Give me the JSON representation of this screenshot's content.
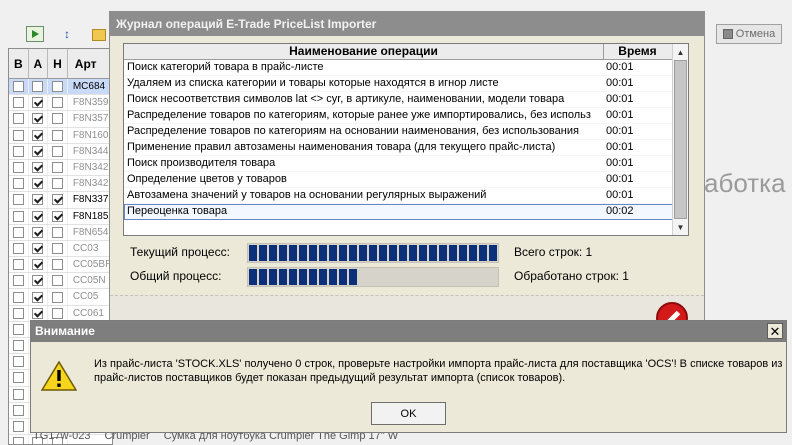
{
  "app": {
    "cancel_label": "Отмена",
    "grid_headers": [
      "В",
      "А",
      "Н",
      "Арт"
    ],
    "grid_rows": [
      {
        "a": false,
        "n": false,
        "art": "MC684",
        "dark": true,
        "sel": true
      },
      {
        "a": true,
        "n": false,
        "art": "F8N359",
        "dark": false
      },
      {
        "a": true,
        "n": false,
        "art": "F8N357",
        "dark": false
      },
      {
        "a": true,
        "n": false,
        "art": "F8N160",
        "dark": false
      },
      {
        "a": true,
        "n": false,
        "art": "F8N344",
        "dark": false
      },
      {
        "a": true,
        "n": false,
        "art": "F8N342",
        "dark": false
      },
      {
        "a": true,
        "n": false,
        "art": "F8N342",
        "dark": false
      },
      {
        "a": true,
        "n": true,
        "art": "F8N337",
        "dark": true
      },
      {
        "a": true,
        "n": true,
        "art": "F8N185",
        "dark": true
      },
      {
        "a": true,
        "n": false,
        "art": "F8N654",
        "dark": false
      },
      {
        "a": true,
        "n": false,
        "art": "CC03",
        "dark": false
      },
      {
        "a": true,
        "n": false,
        "art": "CC05BR",
        "dark": false
      },
      {
        "a": true,
        "n": false,
        "art": "CC05N",
        "dark": false
      },
      {
        "a": true,
        "n": false,
        "art": "CC05",
        "dark": false
      },
      {
        "a": true,
        "n": false,
        "art": "CC061",
        "dark": false
      },
      {
        "a": false,
        "n": false,
        "art": "",
        "dark": false
      },
      {
        "a": false,
        "n": false,
        "art": "",
        "dark": false
      },
      {
        "a": false,
        "n": false,
        "art": "",
        "dark": false
      },
      {
        "a": false,
        "n": false,
        "art": "",
        "dark": false
      },
      {
        "a": false,
        "n": false,
        "art": "",
        "dark": false
      },
      {
        "a": false,
        "n": false,
        "art": "",
        "dark": false
      },
      {
        "a": false,
        "n": false,
        "art": "",
        "dark": false
      },
      {
        "a": false,
        "n": false,
        "art": "",
        "dark": false
      }
    ],
    "background_text": "аботка д",
    "bottom_row": [
      "TG17w-023",
      "Crumpler",
      "Сумка для ноутбука Crumpler The Gimp 17\" W"
    ]
  },
  "log": {
    "title": "Журнал операций E-Trade PriceList Importer",
    "col_name": "Наименование операции",
    "col_time": "Время",
    "rows": [
      {
        "name": "Поиск категорий товара в прайс-листе",
        "time": "00:01"
      },
      {
        "name": "Удаляем из списка категории и товары которые находятся в игнор листе",
        "time": "00:01"
      },
      {
        "name": "Поиск несоответствия символов lat <> cyr, в артикуле, наименовании, модели товара",
        "time": "00:01"
      },
      {
        "name": "Распределение товаров по категориям, которые ранее уже импортировались, без использ",
        "time": "00:01"
      },
      {
        "name": "Распределение товаров по категориям на основании наименования, без использования",
        "time": "00:01"
      },
      {
        "name": "Применение правил автозамены наименования товара (для текущего прайс-листа)",
        "time": "00:01"
      },
      {
        "name": "Поиск производителя товара",
        "time": "00:01"
      },
      {
        "name": "Определение цветов у товаров",
        "time": "00:01"
      },
      {
        "name": "Автозамена значений у товаров на основании регулярных выражений",
        "time": "00:01"
      },
      {
        "name": "Переоценка товара",
        "time": "00:02"
      }
    ],
    "current_label": "Текущий процесс:",
    "overall_label": "Общий процесс:",
    "current_progress": 1.0,
    "overall_progress": 0.44,
    "total_rows": "Всего строк: 1",
    "processed_rows": "Обработано строк: 1"
  },
  "dialog": {
    "title": "Внимание",
    "message": "Из прайс-листа 'STOCK.XLS' получено 0 строк, проверьте настройки импорта прайс-листа для поставщика 'OCS'! В списке товаров из прайс-листов поставщиков будет показан предыдущий результат импорта (список товаров).",
    "ok_label": "OK"
  }
}
